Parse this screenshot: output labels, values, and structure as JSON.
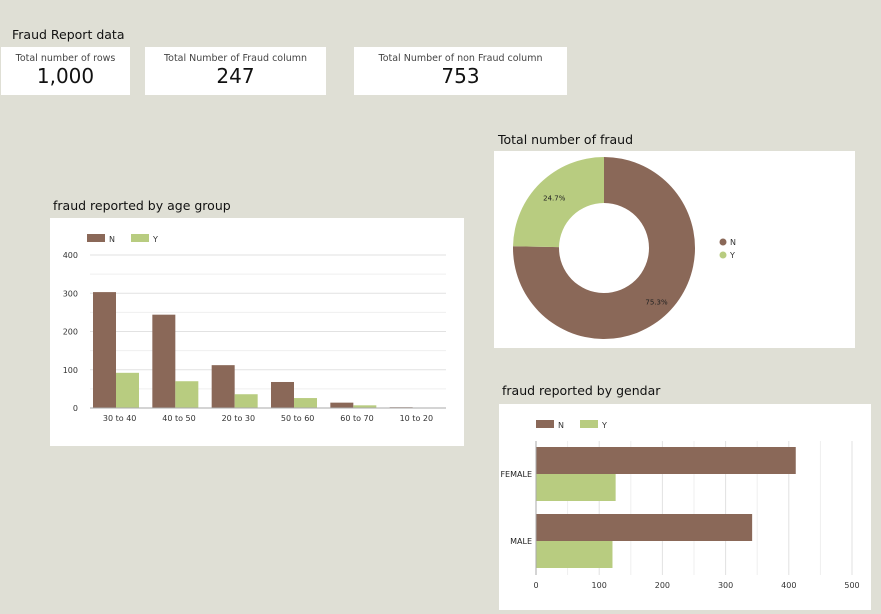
{
  "page": {
    "title": "Fraud Report data"
  },
  "colors": {
    "N": "#8a6858",
    "Y": "#b8cc80",
    "grid": "#e2e2e2",
    "axis": "#aaaaaa"
  },
  "kpis": [
    {
      "label": "Total number of rows",
      "value": "1,000"
    },
    {
      "label": "Total Number of Fraud column",
      "value": "247"
    },
    {
      "label": "Total Number of non Fraud column",
      "value": "753"
    }
  ],
  "chart_data": [
    {
      "id": "age",
      "type": "bar",
      "title": "fraud reported by age group",
      "categories": [
        "30 to 40",
        "40 to 50",
        "20 to 30",
        "50 to 60",
        "60 to 70",
        "10 to 20"
      ],
      "series": [
        {
          "name": "N",
          "values": [
            303,
            244,
            112,
            68,
            14,
            2
          ]
        },
        {
          "name": "Y",
          "values": [
            92,
            70,
            36,
            26,
            7,
            1
          ]
        }
      ],
      "ylim": [
        0,
        400
      ],
      "yticks": [
        "0",
        "100",
        "200",
        "300",
        "400"
      ],
      "grid": true,
      "legend": "top-left"
    },
    {
      "id": "total",
      "type": "pie",
      "title": "Total number of fraud",
      "labels": [
        "N",
        "Y"
      ],
      "values": [
        75.3,
        24.7
      ],
      "value_labels": [
        "75.3%",
        "24.7%"
      ],
      "donut": true,
      "legend": "right"
    },
    {
      "id": "gender",
      "type": "bar",
      "orientation": "horizontal",
      "title": "fraud reported by gendar",
      "categories": [
        "FEMALE",
        "MALE"
      ],
      "series": [
        {
          "name": "N",
          "values": [
            411,
            342
          ]
        },
        {
          "name": "Y",
          "values": [
            126,
            121
          ]
        }
      ],
      "xlim": [
        0,
        500
      ],
      "xticks": [
        "0",
        "100",
        "200",
        "300",
        "400",
        "500"
      ],
      "grid": true,
      "legend": "top-left"
    }
  ]
}
